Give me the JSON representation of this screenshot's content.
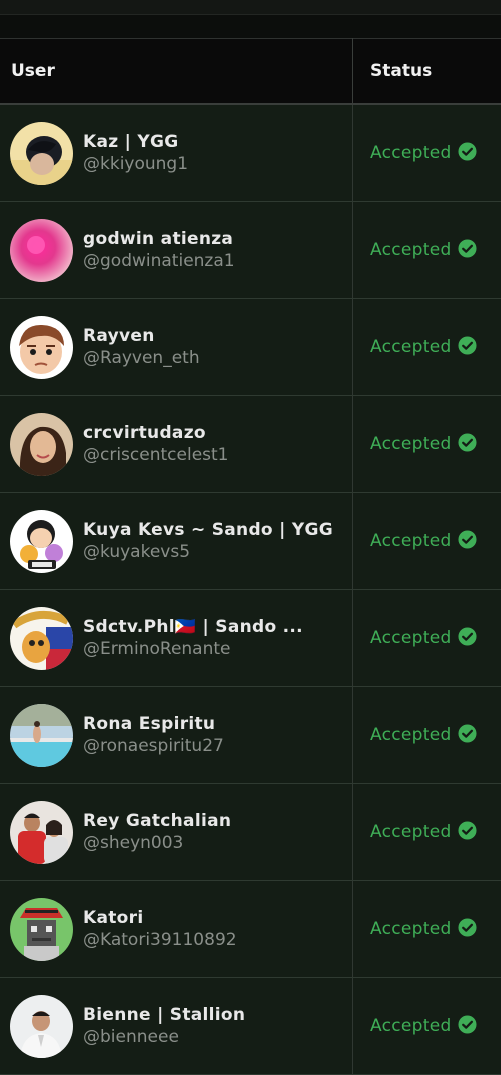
{
  "table": {
    "headers": {
      "user": "User",
      "status": "Status"
    },
    "status_color": "#3fae57",
    "rows": [
      {
        "display_name": "Kaz | YGG",
        "handle": "@kkiyoung1",
        "status": "Accepted",
        "avatar": "avatar-kaz"
      },
      {
        "display_name": "godwin atienza",
        "handle": "@godwinatienza1",
        "status": "Accepted",
        "avatar": "avatar-godwin"
      },
      {
        "display_name": "Rayven",
        "handle": "@Rayven_eth",
        "status": "Accepted",
        "avatar": "avatar-rayven"
      },
      {
        "display_name": "crcvirtudazo",
        "handle": "@criscentcelest1",
        "status": "Accepted",
        "avatar": "avatar-crc"
      },
      {
        "display_name": "Kuya Kevs ~ Sando | YGG",
        "handle": "@kuyakevs5",
        "status": "Accepted",
        "avatar": "avatar-kuyakevs"
      },
      {
        "display_name": "Sdctv.Phl🇵🇭 | Sando ...",
        "handle": "@ErminoRenante",
        "status": "Accepted",
        "avatar": "avatar-sdctv"
      },
      {
        "display_name": "Rona Espiritu",
        "handle": "@ronaespiritu27",
        "status": "Accepted",
        "avatar": "avatar-rona"
      },
      {
        "display_name": "Rey Gatchalian",
        "handle": "@sheyn003",
        "status": "Accepted",
        "avatar": "avatar-rey"
      },
      {
        "display_name": "Katori",
        "handle": "@Katori39110892",
        "status": "Accepted",
        "avatar": "avatar-katori"
      },
      {
        "display_name": "Bienne | Stallion",
        "handle": "@bienneee",
        "status": "Accepted",
        "avatar": "avatar-bienne"
      }
    ]
  }
}
